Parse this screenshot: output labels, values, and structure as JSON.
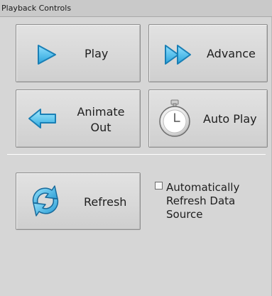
{
  "panel": {
    "title": "Playback Controls"
  },
  "buttons": {
    "play": {
      "label": "Play",
      "icon": "play-arrow-icon"
    },
    "advance": {
      "label": "Advance",
      "icon": "double-arrow-icon"
    },
    "animate_out": {
      "label": "Animate\nOut",
      "icon": "left-arrow-icon"
    },
    "auto_play": {
      "label": "Auto Play",
      "icon": "stopwatch-icon"
    },
    "refresh": {
      "label": "Refresh",
      "icon": "refresh-arrows-icon"
    }
  },
  "options": {
    "auto_refresh": {
      "label": "Automatically\nRefresh Data\nSource",
      "checked": false
    }
  },
  "colors": {
    "icon_blue": "#36b5e8",
    "icon_blue_dark": "#1a7fb5",
    "panel_bg": "#d6d6d6"
  }
}
